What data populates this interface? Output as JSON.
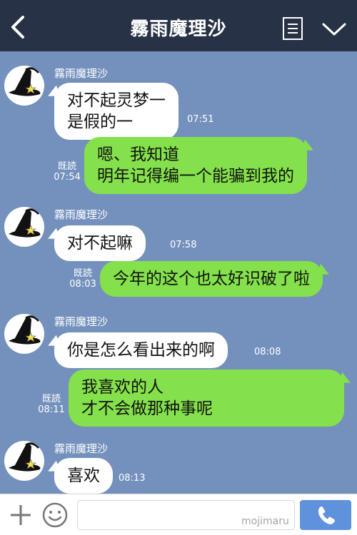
{
  "header": {
    "title": "霧雨魔理沙"
  },
  "messages": [
    {
      "type": "in",
      "sender": "霧雨魔理沙",
      "line1": "对不起灵梦一",
      "line2": "是假的一",
      "time": "07:51"
    },
    {
      "type": "out",
      "read": "既読",
      "line1": "嗯、我知道",
      "line2": "明年记得编一个能骗到我的",
      "time": "07:54"
    },
    {
      "type": "in",
      "sender": "霧雨魔理沙",
      "line1": "对不起嘛",
      "time": "07:58"
    },
    {
      "type": "out",
      "read": "既読",
      "line1": "今年的这个也太好识破了啦",
      "time": "08:03"
    },
    {
      "type": "in",
      "sender": "霧雨魔理沙",
      "line1": "你是怎么看出来的啊",
      "time": "08:08"
    },
    {
      "type": "out",
      "read": "既読",
      "line1": "我喜欢的人",
      "line2": "才不会做那种事呢",
      "time": "08:11"
    },
    {
      "type": "in",
      "sender": "霧雨魔理沙",
      "line1": "喜欢",
      "time": "08:13"
    }
  ],
  "footer": {
    "input_placeholder": "",
    "watermark": "mojimaru"
  },
  "icons": {
    "back": "back-arrow-icon",
    "menu": "menu-list-icon",
    "collapse": "chevron-down-icon",
    "plus": "plus-icon",
    "emoji": "emoji-icon",
    "call": "phone-icon"
  },
  "colors": {
    "header_bg": "#273246",
    "chat_bg": "#7491bd",
    "incoming_bubble": "#ffffff",
    "outgoing_bubble": "#84e14b",
    "call_button": "#5f92dc"
  }
}
